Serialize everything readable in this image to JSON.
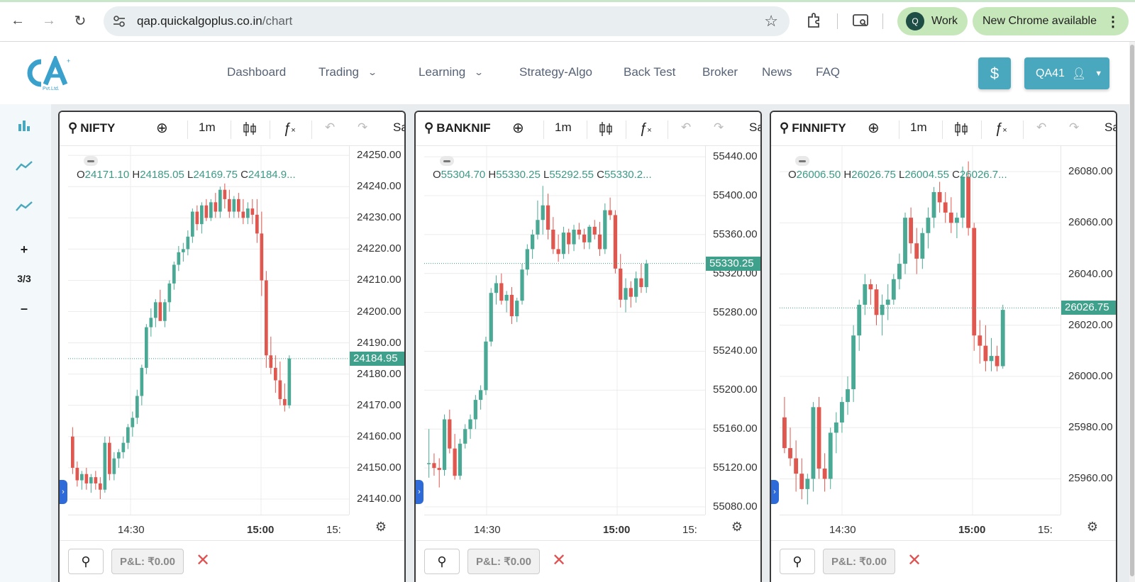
{
  "browser": {
    "url_host": "qap.quickalgoplus.co.in",
    "url_path": "/chart",
    "profile_initial": "Q",
    "profile_label": "Work",
    "update_label": "New Chrome available"
  },
  "app": {
    "logo_text": "Pvt.Ltd.",
    "menu": [
      {
        "label": "Dashboard"
      },
      {
        "label": "Trading"
      },
      {
        "label": "Learning"
      },
      {
        "label": "Strategy-Algo"
      },
      {
        "label": "Back Test"
      },
      {
        "label": "Broker"
      },
      {
        "label": "News"
      },
      {
        "label": "FAQ"
      }
    ],
    "dollar_icon": "$",
    "user_label": "QA41"
  },
  "sidebar": {
    "plus": "+",
    "count": "3/3",
    "minus": "–"
  },
  "panes": [
    {
      "symbol": "NIFTY",
      "interval": "1m",
      "cut_label": "Sa",
      "ohlc": {
        "o": "24171.10",
        "h": "24185.05",
        "l": "24169.75",
        "c": "24184.9..."
      },
      "yticks": [
        "24250.00",
        "24240.00",
        "24230.00",
        "24220.00",
        "24210.00",
        "24200.00",
        "24190.00",
        "24180.00",
        "24170.00",
        "24160.00",
        "24150.00",
        "24140.00"
      ],
      "ylim": [
        24135,
        24253
      ],
      "last_price": "24184.95",
      "last_value": 24184.95,
      "xticks": [
        "14:30",
        "15:00",
        "15:"
      ],
      "pnl": "P&L: ₹0.00",
      "chart_data": {
        "type": "candlestick",
        "ylim": [
          24135,
          24253
        ],
        "candles": [
          [
            24160,
            24163,
            24148,
            24150
          ],
          [
            24150,
            24152,
            24144,
            24146
          ],
          [
            24146,
            24149,
            24143,
            24148
          ],
          [
            24148,
            24150,
            24143,
            24145
          ],
          [
            24145,
            24148,
            24142,
            24147
          ],
          [
            24147,
            24149,
            24143,
            24145
          ],
          [
            24145,
            24147,
            24140,
            24143
          ],
          [
            24143,
            24160,
            24142,
            24158
          ],
          [
            24158,
            24160,
            24146,
            24148
          ],
          [
            24148,
            24155,
            24146,
            24153
          ],
          [
            24153,
            24156,
            24150,
            24155
          ],
          [
            24155,
            24160,
            24153,
            24158
          ],
          [
            24158,
            24164,
            24156,
            24163
          ],
          [
            24163,
            24168,
            24160,
            24166
          ],
          [
            24166,
            24175,
            24164,
            24173
          ],
          [
            24173,
            24183,
            24170,
            24182
          ],
          [
            24182,
            24196,
            24180,
            24195
          ],
          [
            24195,
            24201,
            24192,
            24198
          ],
          [
            24198,
            24204,
            24195,
            24203
          ],
          [
            24203,
            24207,
            24197,
            24197
          ],
          [
            24197,
            24204,
            24195,
            24203
          ],
          [
            24203,
            24210,
            24200,
            24209
          ],
          [
            24209,
            24216,
            24207,
            24215
          ],
          [
            24215,
            24221,
            24213,
            24219
          ],
          [
            24219,
            24222,
            24216,
            24220
          ],
          [
            24220,
            24226,
            24218,
            24224
          ],
          [
            24224,
            24233,
            24222,
            24232
          ],
          [
            24232,
            24234,
            24226,
            24228
          ],
          [
            24228,
            24235,
            24225,
            24234
          ],
          [
            24234,
            24236,
            24229,
            24230
          ],
          [
            24230,
            24236,
            24229,
            24235
          ],
          [
            24235,
            24238,
            24230,
            24232
          ],
          [
            24232,
            24240,
            24230,
            24239
          ],
          [
            24239,
            24241,
            24233,
            24236
          ],
          [
            24236,
            24239,
            24230,
            24232
          ],
          [
            24232,
            24237,
            24230,
            24236
          ],
          [
            24236,
            24238,
            24230,
            24232
          ],
          [
            24232,
            24236,
            24228,
            24230
          ],
          [
            24230,
            24235,
            24228,
            24233
          ],
          [
            24233,
            24236,
            24228,
            24231
          ],
          [
            24231,
            24236,
            24222,
            24225
          ],
          [
            24225,
            24232,
            24205,
            24210
          ],
          [
            24210,
            24213,
            24182,
            24186
          ],
          [
            24186,
            24192,
            24180,
            24182
          ],
          [
            24182,
            24186,
            24174,
            24178
          ],
          [
            24178,
            24184,
            24170,
            24172
          ],
          [
            24172,
            24177,
            24168,
            24170
          ],
          [
            24170,
            24186,
            24169,
            24185
          ]
        ]
      }
    },
    {
      "symbol": "BANKNIF",
      "interval": "1m",
      "cut_label": "Sa",
      "ohlc": {
        "o": "55304.70",
        "h": "55330.25",
        "l": "55292.55",
        "c": "55330.2..."
      },
      "yticks": [
        "55440.00",
        "55400.00",
        "55360.00",
        "55320.00",
        "55280.00",
        "55240.00",
        "55200.00",
        "55160.00",
        "55120.00",
        "55080.00"
      ],
      "ylim": [
        55072,
        55451
      ],
      "last_price": "55330.25",
      "last_value": 55330.25,
      "xticks": [
        "14:30",
        "15:00",
        "15:"
      ],
      "pnl": "P&L: ₹0.00",
      "chart_data": {
        "type": "candlestick",
        "ylim": [
          55072,
          55451
        ],
        "candles": [
          [
            55125,
            55160,
            55110,
            55125
          ],
          [
            55125,
            55135,
            55112,
            55120
          ],
          [
            55120,
            55130,
            55100,
            55118
          ],
          [
            55118,
            55175,
            55112,
            55170
          ],
          [
            55170,
            55180,
            55135,
            55140
          ],
          [
            55140,
            55155,
            55108,
            55112
          ],
          [
            55112,
            55150,
            55108,
            55145
          ],
          [
            55145,
            55165,
            55140,
            55160
          ],
          [
            55160,
            55175,
            55150,
            55170
          ],
          [
            55170,
            55195,
            55160,
            55190
          ],
          [
            55190,
            55205,
            55180,
            55200
          ],
          [
            55200,
            55255,
            55195,
            55250
          ],
          [
            55250,
            55305,
            55245,
            55300
          ],
          [
            55300,
            55318,
            55288,
            55310
          ],
          [
            55310,
            55320,
            55288,
            55292
          ],
          [
            55292,
            55302,
            55280,
            55298
          ],
          [
            55298,
            55306,
            55268,
            55276
          ],
          [
            55276,
            55295,
            55270,
            55292
          ],
          [
            55292,
            55330,
            55288,
            55324
          ],
          [
            55324,
            55350,
            55318,
            55345
          ],
          [
            55345,
            55365,
            55335,
            55360
          ],
          [
            55360,
            55395,
            55355,
            55375
          ],
          [
            55375,
            55410,
            55360,
            55390
          ],
          [
            55390,
            55402,
            55355,
            55365
          ],
          [
            55365,
            55378,
            55340,
            55345
          ],
          [
            55345,
            55360,
            55332,
            55340
          ],
          [
            55340,
            55368,
            55335,
            55362
          ],
          [
            55362,
            55366,
            55340,
            55350
          ],
          [
            55350,
            55370,
            55343,
            55365
          ],
          [
            55365,
            55372,
            55355,
            55360
          ],
          [
            55360,
            55366,
            55345,
            55352
          ],
          [
            55352,
            55370,
            55345,
            55368
          ],
          [
            55368,
            55375,
            55355,
            55360
          ],
          [
            55360,
            55373,
            55338,
            55345
          ],
          [
            55345,
            55392,
            55340,
            55385
          ],
          [
            55385,
            55398,
            55375,
            55380
          ],
          [
            55380,
            55385,
            55320,
            55325
          ],
          [
            55325,
            55340,
            55285,
            55293
          ],
          [
            55293,
            55315,
            55280,
            55305
          ],
          [
            55305,
            55312,
            55285,
            55296
          ],
          [
            55296,
            55322,
            55290,
            55315
          ],
          [
            55315,
            55330,
            55300,
            55306
          ],
          [
            55306,
            55334,
            55300,
            55330
          ]
        ]
      }
    },
    {
      "symbol": "FINNIFTY",
      "interval": "1m",
      "cut_label": "Sa",
      "ohlc": {
        "o": "26006.50",
        "h": "26026.75",
        "l": "26004.55",
        "c": "26026.7..."
      },
      "yticks": [
        "26080.00",
        "26060.00",
        "26040.00",
        "26020.00",
        "26000.00",
        "25980.00",
        "25960.00"
      ],
      "ylim": [
        25946,
        26090
      ],
      "last_price": "26026.75",
      "last_value": 26026.75,
      "xticks": [
        "14:30",
        "15:00",
        "15:"
      ],
      "pnl": "P&L: ₹0.00",
      "chart_data": {
        "type": "candlestick",
        "ylim": [
          25946,
          26090
        ],
        "candles": [
          [
            25984,
            25992,
            25970,
            25972
          ],
          [
            25972,
            25980,
            25965,
            25968
          ],
          [
            25968,
            25975,
            25955,
            25962
          ],
          [
            25962,
            25968,
            25952,
            25956
          ],
          [
            25956,
            25962,
            25950,
            25960
          ],
          [
            25960,
            25990,
            25955,
            25988
          ],
          [
            25988,
            25992,
            25960,
            25964
          ],
          [
            25964,
            25970,
            25955,
            25960
          ],
          [
            25960,
            25980,
            25956,
            25978
          ],
          [
            25978,
            25986,
            25970,
            25982
          ],
          [
            25982,
            25992,
            25978,
            25990
          ],
          [
            25990,
            26000,
            25985,
            25995
          ],
          [
            25995,
            26020,
            25990,
            26016
          ],
          [
            26016,
            26030,
            26010,
            26028
          ],
          [
            26028,
            26040,
            26024,
            26036
          ],
          [
            26036,
            26038,
            26028,
            26034
          ],
          [
            26034,
            26036,
            26020,
            26024
          ],
          [
            26024,
            26032,
            26016,
            26028
          ],
          [
            26028,
            26036,
            26022,
            26030
          ],
          [
            26030,
            26040,
            26028,
            26038
          ],
          [
            26038,
            26048,
            26034,
            26044
          ],
          [
            26044,
            26064,
            26040,
            26062
          ],
          [
            26062,
            26066,
            26048,
            26052
          ],
          [
            26052,
            26058,
            26040,
            26046
          ],
          [
            26046,
            26058,
            26042,
            26056
          ],
          [
            26056,
            26066,
            26050,
            26062
          ],
          [
            26062,
            26074,
            26058,
            26072
          ],
          [
            26072,
            26076,
            26064,
            26068
          ],
          [
            26068,
            26072,
            26060,
            26064
          ],
          [
            26064,
            26070,
            26056,
            26060
          ],
          [
            26060,
            26064,
            26054,
            26062
          ],
          [
            26062,
            26082,
            26058,
            26078
          ],
          [
            26078,
            26084,
            26055,
            26058
          ],
          [
            26058,
            26060,
            26010,
            26016
          ],
          [
            26016,
            26022,
            26005,
            26012
          ],
          [
            26012,
            26020,
            26002,
            26006
          ],
          [
            26006,
            26015,
            26002,
            26008
          ],
          [
            26008,
            26012,
            26002,
            26004
          ],
          [
            26004,
            26028,
            26003,
            26026
          ]
        ]
      }
    }
  ]
}
